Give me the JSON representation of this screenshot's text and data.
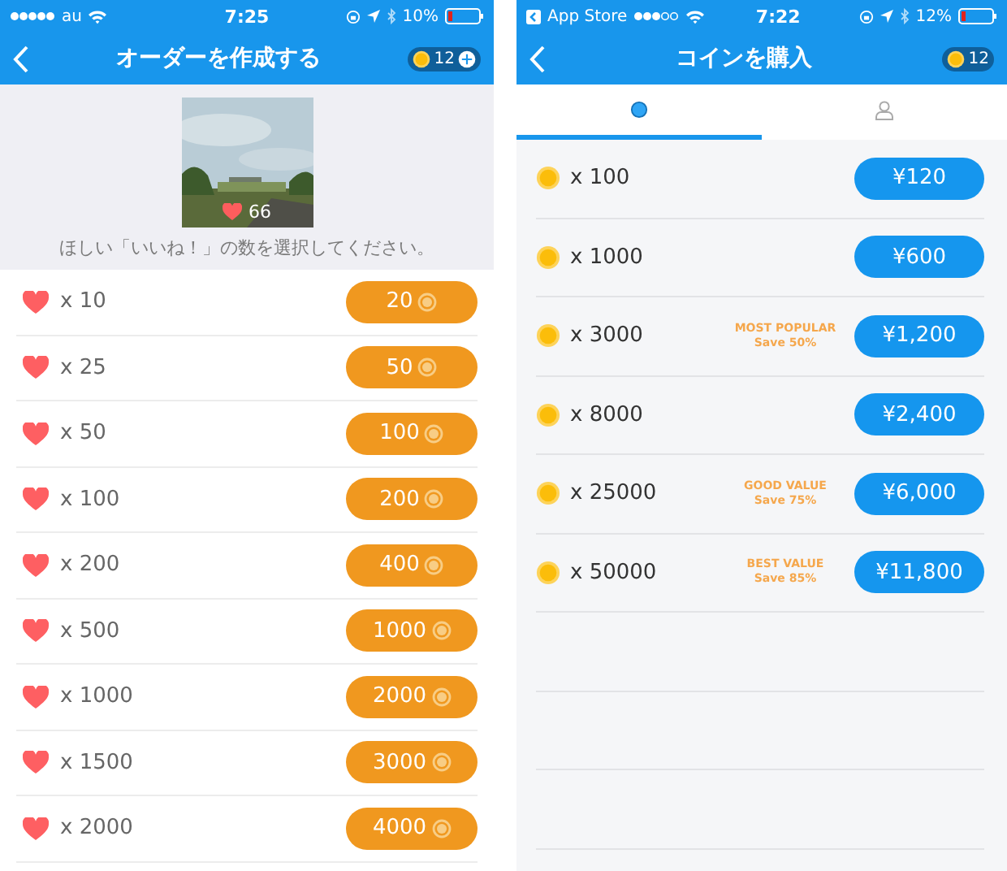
{
  "order_screen": {
    "status_bar": {
      "carrier": "au",
      "time": "7:25",
      "battery": "10%"
    },
    "nav_bar": {
      "title": "オーダーを作成する",
      "coin_count": "12"
    },
    "post": {
      "kind": "picture",
      "likes": "66"
    },
    "prompt": "ほしい「いいね！」の数を選択してください。",
    "options": [
      {
        "quantity": "x 10",
        "price": "20"
      },
      {
        "quantity": "x 25",
        "price": "50"
      },
      {
        "quantity": "x 50",
        "price": "100"
      },
      {
        "quantity": "x 100",
        "price": "200"
      },
      {
        "quantity": "x 200",
        "price": "400"
      },
      {
        "quantity": "x 500",
        "price": "1000"
      },
      {
        "quantity": "x 1000",
        "price": "2000"
      },
      {
        "quantity": "x 1500",
        "price": "3000"
      },
      {
        "quantity": "x 2000",
        "price": "4000"
      }
    ]
  },
  "coin_screen": {
    "status_bar": {
      "back_app": "App Store",
      "time": "7:22",
      "battery": "12%"
    },
    "nav_bar": {
      "title": "コインを購入",
      "coin_count": "12"
    },
    "tabs": [
      {
        "kind": "coins",
        "selected": true
      },
      {
        "kind": "profile",
        "selected": false
      }
    ],
    "packages": [
      {
        "quantity": "x 100",
        "price": "¥120"
      },
      {
        "quantity": "x 1000",
        "price": "¥600"
      },
      {
        "quantity": "x 3000",
        "price": "¥1,200",
        "badge": "MOST POPULAR",
        "saving": "Save 50%"
      },
      {
        "quantity": "x 8000",
        "price": "¥2,400"
      },
      {
        "quantity": "x 25000",
        "price": "¥6,000",
        "badge": "GOOD VALUE",
        "saving": "Save 75%"
      },
      {
        "quantity": "x 50000",
        "price": "¥11,800",
        "badge": "BEST VALUE",
        "saving": "Save 85%"
      }
    ]
  }
}
